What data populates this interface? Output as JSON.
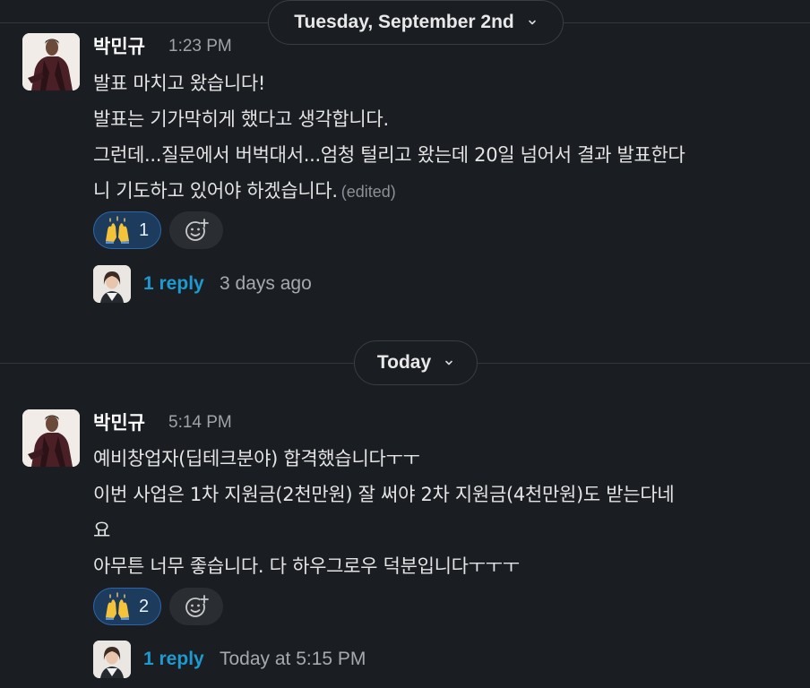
{
  "dividers": [
    {
      "label": "Tuesday, September 2nd"
    },
    {
      "label": "Today"
    }
  ],
  "messages": [
    {
      "author": "박민규",
      "time": "1:23 PM",
      "lines": [
        "발표 마치고 왔습니다!",
        "발표는 기가막히게 했다고 생각합니다.",
        "그런데...질문에서 버벅대서...엄청 털리고 왔는데 20일 넘어서 결과 발표한다",
        "니 기도하고 있어야 하겠습니다."
      ],
      "edited": "(edited)",
      "reaction": {
        "emoji": "raised-hands-emoji",
        "count": "1"
      },
      "reply": {
        "label": "1 reply",
        "time": "3 days ago"
      }
    },
    {
      "author": "박민규",
      "time": "5:14 PM",
      "lines": [
        "예비창업자(딥테크분야) 합격했습니다ㅜㅜ",
        "이번 사업은 1차 지원금(2천만원) 잘 써야 2차 지원금(4천만원)도 받는다네",
        "요",
        "아무튼 너무 좋습니다. 다 하우그로우 덕분입니다ㅜㅜㅜ"
      ],
      "edited": "",
      "reaction": {
        "emoji": "raised-hands-emoji",
        "count": "2"
      },
      "reply": {
        "label": "1 reply",
        "time": "Today at 5:15 PM"
      }
    }
  ],
  "icons": {
    "chevron": "chevron-down-icon",
    "add_reaction": "add-reaction-icon"
  },
  "colors": {
    "background": "#1a1d21",
    "link": "#1d9bd1",
    "reaction_bg": "#1d3b5c",
    "reaction_border": "#2b67a8"
  }
}
